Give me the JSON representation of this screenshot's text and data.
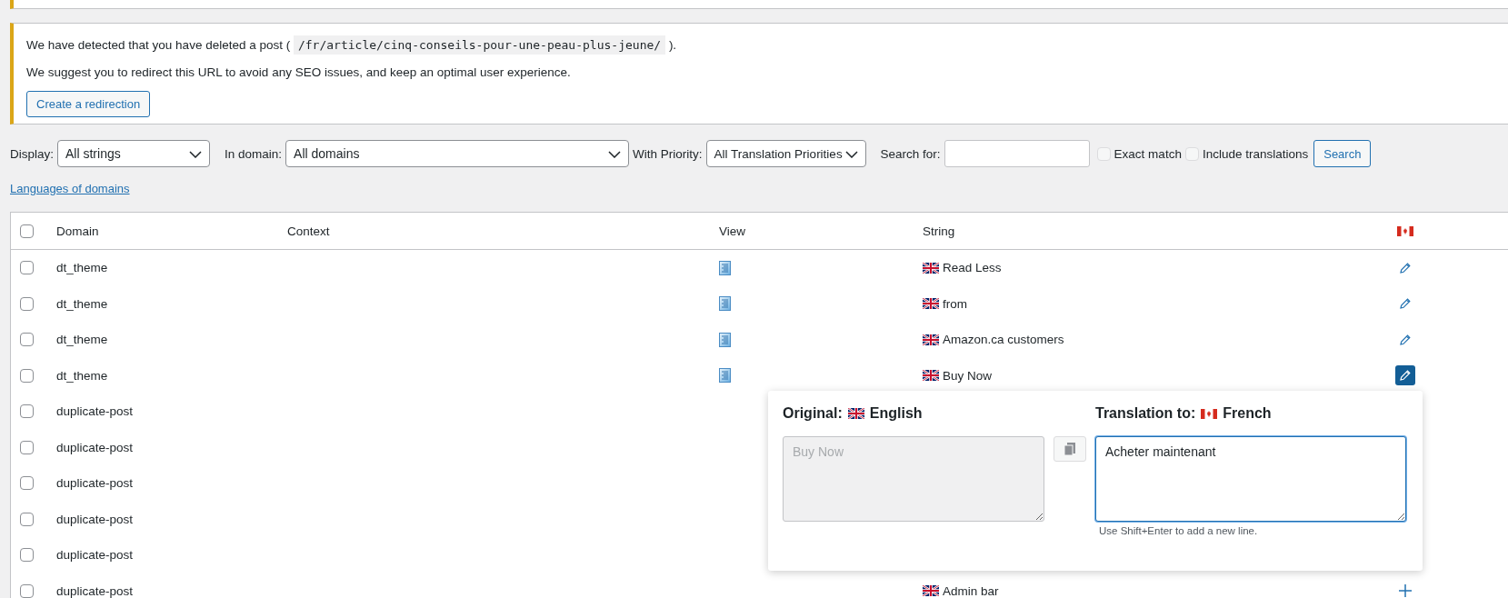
{
  "notice": {
    "text_before": "We have detected that you have deleted a post (",
    "path": "/fr/article/cinq-conseils-pour-une-peau-plus-jeune/",
    "text_after": ").",
    "suggestion": "We suggest you to redirect this URL to avoid any SEO issues, and keep an optimal user experience.",
    "button": "Create a redirection"
  },
  "filters": {
    "display_label": "Display:",
    "display_value": "All strings",
    "domain_label": "In domain:",
    "domain_value": "All domains",
    "priority_label": "With Priority:",
    "priority_value": "All Translation Priorities",
    "search_label": "Search for:",
    "exact_match": {
      "label": "Exact match",
      "checked": false
    },
    "include_translations": {
      "label": "Include translations",
      "checked": false
    },
    "search_button": "Search"
  },
  "languages_link": "Languages of domains",
  "table": {
    "select_all_checked": false,
    "columns": [
      "Domain",
      "Context",
      "View",
      "String"
    ],
    "rows": [
      {
        "domain": "dt_theme",
        "checked": false,
        "view_icon": true,
        "string": "Read Less",
        "kind": "edit",
        "selected": false
      },
      {
        "domain": "dt_theme",
        "checked": false,
        "view_icon": true,
        "string": "from",
        "kind": "edit",
        "selected": false
      },
      {
        "domain": "dt_theme",
        "checked": false,
        "view_icon": true,
        "string": "Amazon.ca customers",
        "kind": "edit",
        "selected": false
      },
      {
        "domain": "dt_theme",
        "checked": false,
        "view_icon": true,
        "string": "Buy Now",
        "kind": "edit",
        "selected": true
      },
      {
        "domain": "duplicate-post",
        "checked": false,
        "view_icon": false
      },
      {
        "domain": "duplicate-post",
        "checked": false,
        "view_icon": false
      },
      {
        "domain": "duplicate-post",
        "checked": false,
        "view_icon": false
      },
      {
        "domain": "duplicate-post",
        "checked": false,
        "view_icon": false
      },
      {
        "domain": "duplicate-post",
        "checked": false,
        "view_icon": false
      },
      {
        "domain": "duplicate-post",
        "checked": false,
        "view_icon": false,
        "string": "Admin bar",
        "kind": "add",
        "selected": false
      }
    ]
  },
  "popup": {
    "original_label": "Original:",
    "original_language": "English",
    "translation_label": "Translation to:",
    "translation_language": "French",
    "original_text": "Buy Now",
    "original_disabled": true,
    "translation_value": "Acheter maintenant",
    "hint": "Use Shift+Enter to add a new line."
  }
}
